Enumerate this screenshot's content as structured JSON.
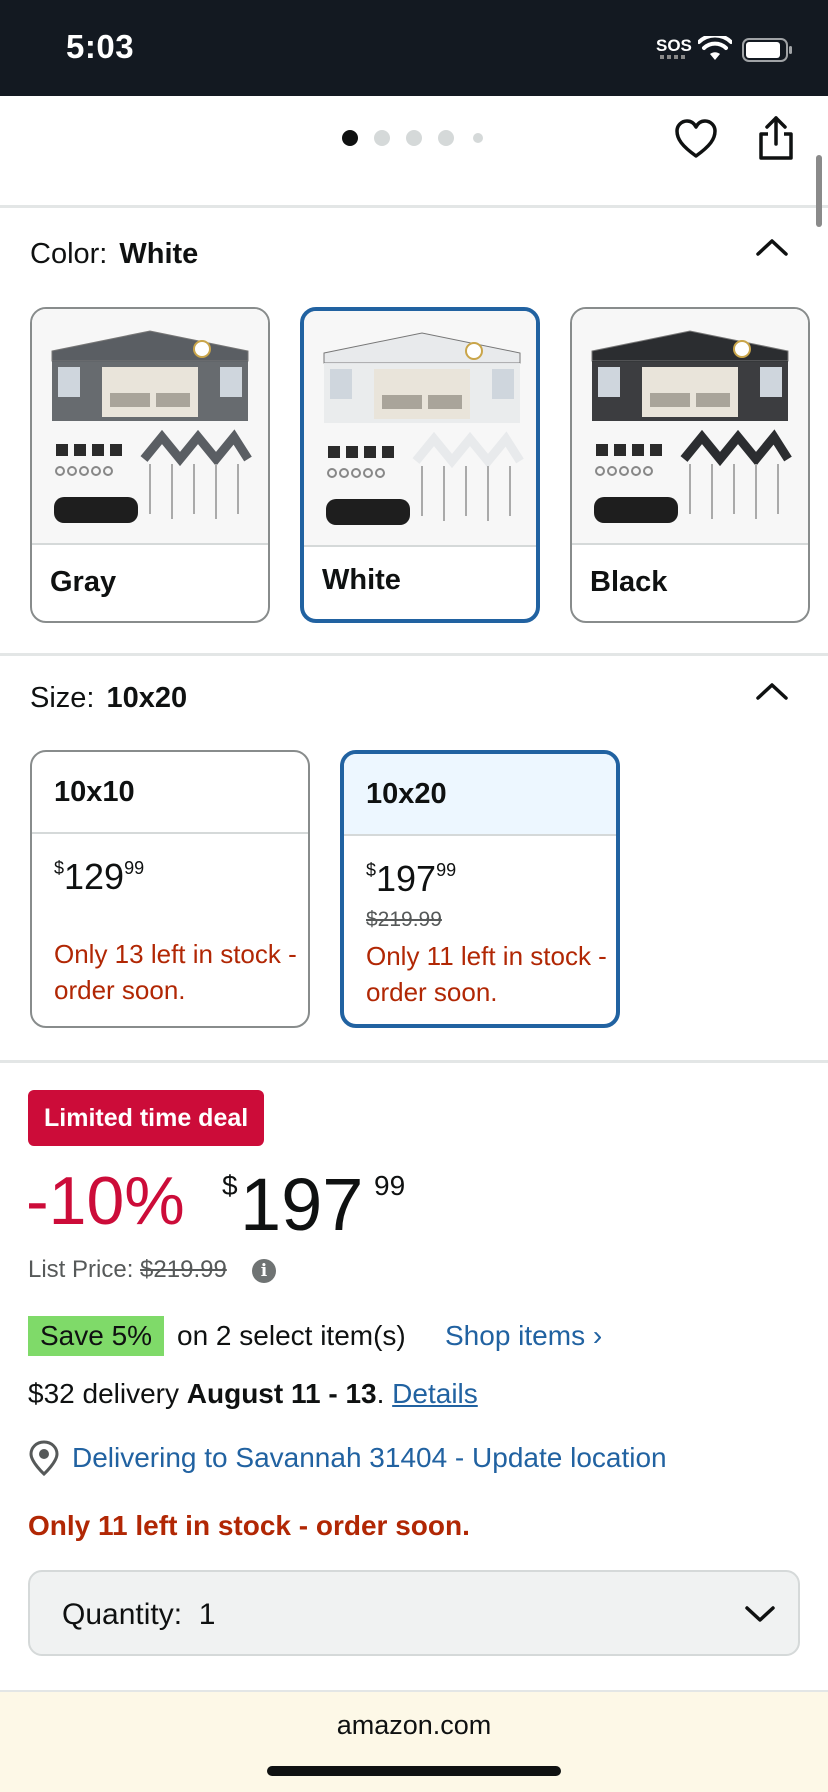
{
  "status_bar": {
    "time": "5:03",
    "sos": "SOS"
  },
  "image_carousel": {
    "pages": 5,
    "current": 1
  },
  "color_section": {
    "label": "Color:",
    "selected": "White",
    "options": [
      {
        "name": "Gray",
        "tent_color": "#5a5e63"
      },
      {
        "name": "White",
        "tent_color": "#e8eaec"
      },
      {
        "name": "Black",
        "tent_color": "#2b2d30"
      }
    ]
  },
  "size_section": {
    "label": "Size:",
    "selected": "10x20",
    "options": [
      {
        "name": "10x10",
        "price_symbol": "$",
        "price_whole": "129",
        "price_fraction": "99",
        "list_price": "",
        "stock": "Only 13 left in stock - order soon."
      },
      {
        "name": "10x20",
        "price_symbol": "$",
        "price_whole": "197",
        "price_fraction": "99",
        "list_price": "$219.99",
        "stock": "Only 11 left in stock - order soon."
      }
    ]
  },
  "buy_box": {
    "deal_badge": "Limited time deal",
    "discount": "-10%",
    "price_symbol": "$",
    "price_whole": "197",
    "price_fraction": "99",
    "list_price_label": "List Price:",
    "list_price": "$219.99",
    "save_badge": "Save 5%",
    "save_text": "on 2 select item(s)",
    "shop_link": "Shop items ›",
    "delivery_prefix": "$32 delivery",
    "delivery_dates": "August 11 - 13",
    "delivery_link": "Details",
    "location": "Delivering to Savannah 31404 - Update location",
    "stock": "Only 11 left in stock - order soon.",
    "quantity_label": "Quantity:",
    "quantity_value": "1"
  },
  "browser": {
    "domain": "amazon.com"
  },
  "colors": {
    "accent_blue": "#2162a1",
    "deal_red": "#cc0c39",
    "stock_red": "#b12704",
    "save_green": "#7fda69"
  }
}
